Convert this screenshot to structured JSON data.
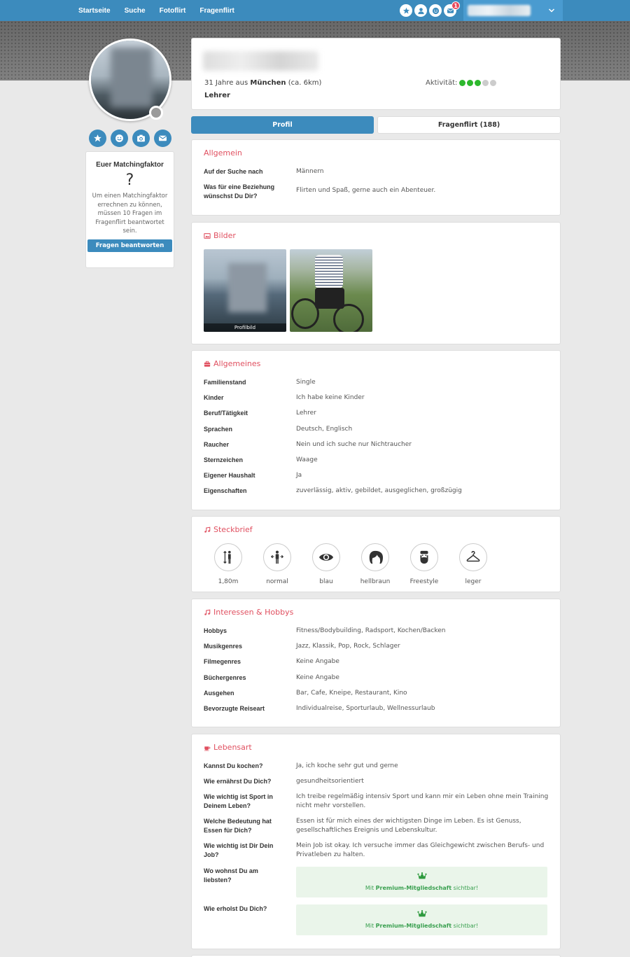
{
  "nav": {
    "links": [
      "Startseite",
      "Suche",
      "Fotoflirt",
      "Fragenflirt"
    ],
    "icons": [
      "star-icon",
      "user-icon",
      "smiley-icon",
      "envelope-icon"
    ],
    "message_badge": "1"
  },
  "sidebar": {
    "actions": [
      "star-icon",
      "smiley-icon",
      "camera-icon",
      "envelope-icon"
    ],
    "match": {
      "title": "Euer Matchingfaktor",
      "value": "?",
      "description": "Um einen Matchingfaktor errechnen zu können, müssen 10 Fragen im Fragenflirt beantwortet sein.",
      "button": "Fragen beantworten"
    }
  },
  "profile": {
    "age_prefix": "31 Jahre aus ",
    "city": "München",
    "distance": " (ca. 6km)",
    "job": "Lehrer",
    "activity_label": "Aktivität:",
    "activity_level": 3,
    "activity_max": 5
  },
  "tabs": {
    "profil": "Profil",
    "fragenflirt": "Fragenflirt (188)"
  },
  "allgemein": {
    "title": "Allgemein",
    "rows": [
      {
        "label": "Auf der Suche nach",
        "value": "Männern"
      },
      {
        "label": "Was für eine Beziehung wünschst Du Dir?",
        "value": "Flirten und Spaß, gerne auch ein Abenteuer."
      }
    ]
  },
  "bilder": {
    "title": "Bilder",
    "caption": "Profilbild"
  },
  "allgemeines": {
    "title": "Allgemeines",
    "rows": [
      {
        "label": "Familienstand",
        "value": "Single"
      },
      {
        "label": "Kinder",
        "value": "Ich habe keine Kinder"
      },
      {
        "label": "Beruf/Tätigkeit",
        "value": "Lehrer"
      },
      {
        "label": "Sprachen",
        "value": "Deutsch, Englisch"
      },
      {
        "label": "Raucher",
        "value": "Nein und ich suche nur Nichtraucher"
      },
      {
        "label": "Sternzeichen",
        "value": "Waage"
      },
      {
        "label": "Eigener Haushalt",
        "value": "Ja"
      },
      {
        "label": "Eigenschaften",
        "value": "zuverlässig, aktiv, gebildet, ausgeglichen, großzügig"
      }
    ]
  },
  "steckbrief": {
    "title": "Steckbrief",
    "items": [
      {
        "icon": "height-icon",
        "label": "1,80m"
      },
      {
        "icon": "body-icon",
        "label": "normal"
      },
      {
        "icon": "eye-icon",
        "label": "blau"
      },
      {
        "icon": "hair-icon",
        "label": "hellbraun"
      },
      {
        "icon": "beard-icon",
        "label": "Freestyle"
      },
      {
        "icon": "hanger-icon",
        "label": "leger"
      }
    ]
  },
  "interessen": {
    "title": "Interessen & Hobbys",
    "rows": [
      {
        "label": "Hobbys",
        "value": "Fitness/Bodybuilding, Radsport, Kochen/Backen"
      },
      {
        "label": "Musikgenres",
        "value": "Jazz, Klassik, Pop, Rock, Schlager"
      },
      {
        "label": "Filmegenres",
        "value": "Keine Angabe"
      },
      {
        "label": "Büchergenres",
        "value": "Keine Angabe"
      },
      {
        "label": "Ausgehen",
        "value": "Bar, Cafe, Kneipe, Restaurant, Kino"
      },
      {
        "label": "Bevorzugte Reiseart",
        "value": "Individualreise, Sporturlaub, Wellnessurlaub"
      }
    ]
  },
  "lebensart": {
    "title": "Lebensart",
    "rows": [
      {
        "label": "Kannst Du kochen?",
        "value": "Ja, ich koche sehr gut und gerne"
      },
      {
        "label": "Wie ernährst Du Dich?",
        "value": "gesundheitsorientiert"
      },
      {
        "label": "Wie wichtig ist Sport in Deinem Leben?",
        "value": "Ich treibe regelmäßig intensiv Sport und kann mir ein Leben ohne mein Training nicht mehr vorstellen."
      },
      {
        "label": "Welche Bedeutung hat Essen für Dich?",
        "value": "Essen ist für mich eines der wichtigsten Dinge im Leben. Es ist Genuss, gesellschaftliches Ereignis und Lebenskultur."
      },
      {
        "label": "Wie wichtig ist Dir Dein Job?",
        "value": "Mein Job ist okay. Ich versuche immer das Gleichgewicht zwischen Berufs- und Privatleben zu halten."
      },
      {
        "label": "Wo wohnst Du am liebsten?",
        "value": ""
      },
      {
        "label": "Wie erholst Du Dich?",
        "value": ""
      }
    ],
    "premium_prefix": "Mit ",
    "premium_bold": "Premium-Mitgliedschaft",
    "premium_suffix": " sichtbar!"
  },
  "colors": {
    "primary": "#3c8bbd",
    "accent": "#e05060",
    "activity_on": "#2db82d",
    "activity_off": "#cccccc",
    "premium_bg": "#eaf5ea"
  }
}
